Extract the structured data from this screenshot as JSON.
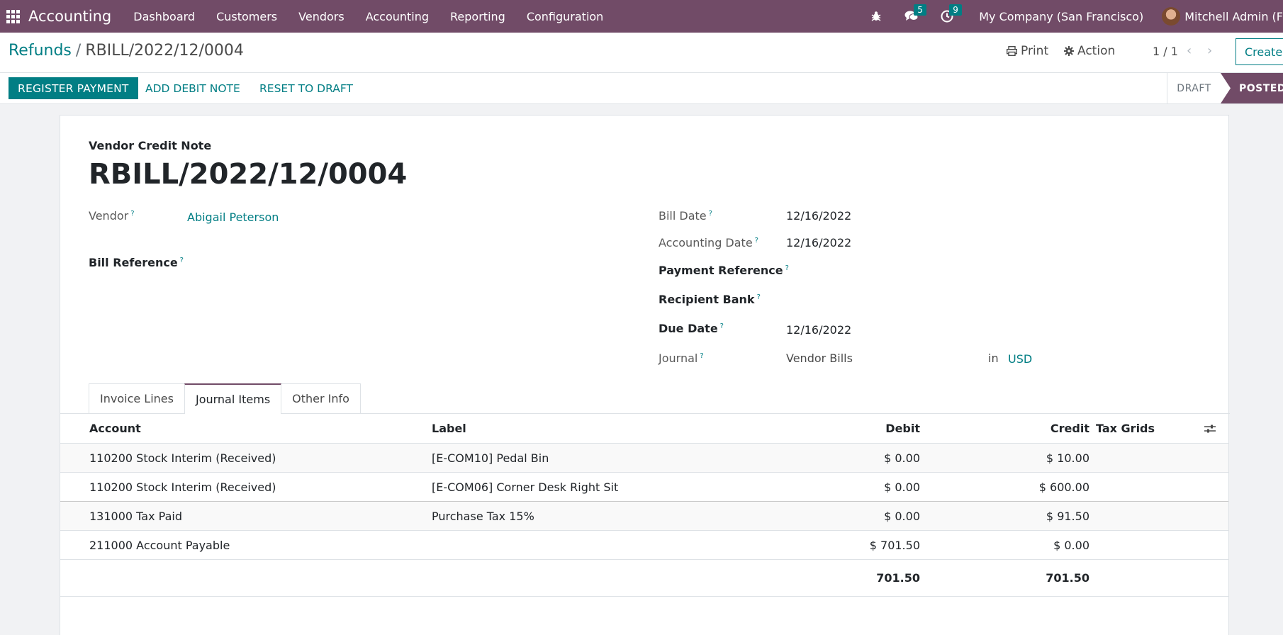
{
  "navbar": {
    "app_name": "Accounting",
    "menu": [
      "Dashboard",
      "Customers",
      "Vendors",
      "Accounting",
      "Reporting",
      "Configuration"
    ],
    "messages_count": "5",
    "activities_count": "9",
    "company": "My Company (San Francisco)",
    "user": "Mitchell Admin (F"
  },
  "control": {
    "breadcrumb_parent": "Refunds",
    "breadcrumb_current": "RBILL/2022/12/0004",
    "print_label": "Print",
    "action_label": "Action",
    "pager": "1 / 1",
    "create_label": "Create"
  },
  "statusbar": {
    "register_payment": "REGISTER PAYMENT",
    "add_debit_note": "ADD DEBIT NOTE",
    "reset_to_draft": "RESET TO DRAFT",
    "stage_draft": "DRAFT",
    "stage_posted": "POSTED"
  },
  "form": {
    "doc_type": "Vendor Credit Note",
    "name": "RBILL/2022/12/0004",
    "help_mark": "?",
    "vendor_label": "Vendor",
    "vendor_value": "Abigail Peterson",
    "bill_reference_label": "Bill Reference",
    "bill_date_label": "Bill Date",
    "bill_date_value": "12/16/2022",
    "accounting_date_label": "Accounting Date",
    "accounting_date_value": "12/16/2022",
    "payment_reference_label": "Payment Reference",
    "recipient_bank_label": "Recipient Bank",
    "due_date_label": "Due Date",
    "due_date_value": "12/16/2022",
    "journal_label": "Journal",
    "journal_value": "Vendor Bills",
    "journal_in": "in",
    "currency": "USD"
  },
  "tabs": [
    "Invoice Lines",
    "Journal Items",
    "Other Info"
  ],
  "journal_items": {
    "columns": {
      "account": "Account",
      "label": "Label",
      "debit": "Debit",
      "credit": "Credit",
      "tax_grids": "Tax Grids"
    },
    "rows": [
      {
        "account": "110200 Stock Interim (Received)",
        "label": "[E-COM10] Pedal Bin",
        "debit": "$ 0.00",
        "credit": "$ 10.00"
      },
      {
        "account": "110200 Stock Interim (Received)",
        "label": "[E-COM06] Corner Desk Right Sit",
        "debit": "$ 0.00",
        "credit": "$ 600.00"
      },
      {
        "account": "131000 Tax Paid",
        "label": "Purchase Tax 15%",
        "debit": "$ 0.00",
        "credit": "$ 91.50"
      },
      {
        "account": "211000 Account Payable",
        "label": "",
        "debit": "$ 701.50",
        "credit": "$ 0.00"
      }
    ],
    "totals": {
      "debit": "701.50",
      "credit": "701.50"
    }
  },
  "colors": {
    "brand": "#714b67",
    "accent": "#017e84"
  }
}
